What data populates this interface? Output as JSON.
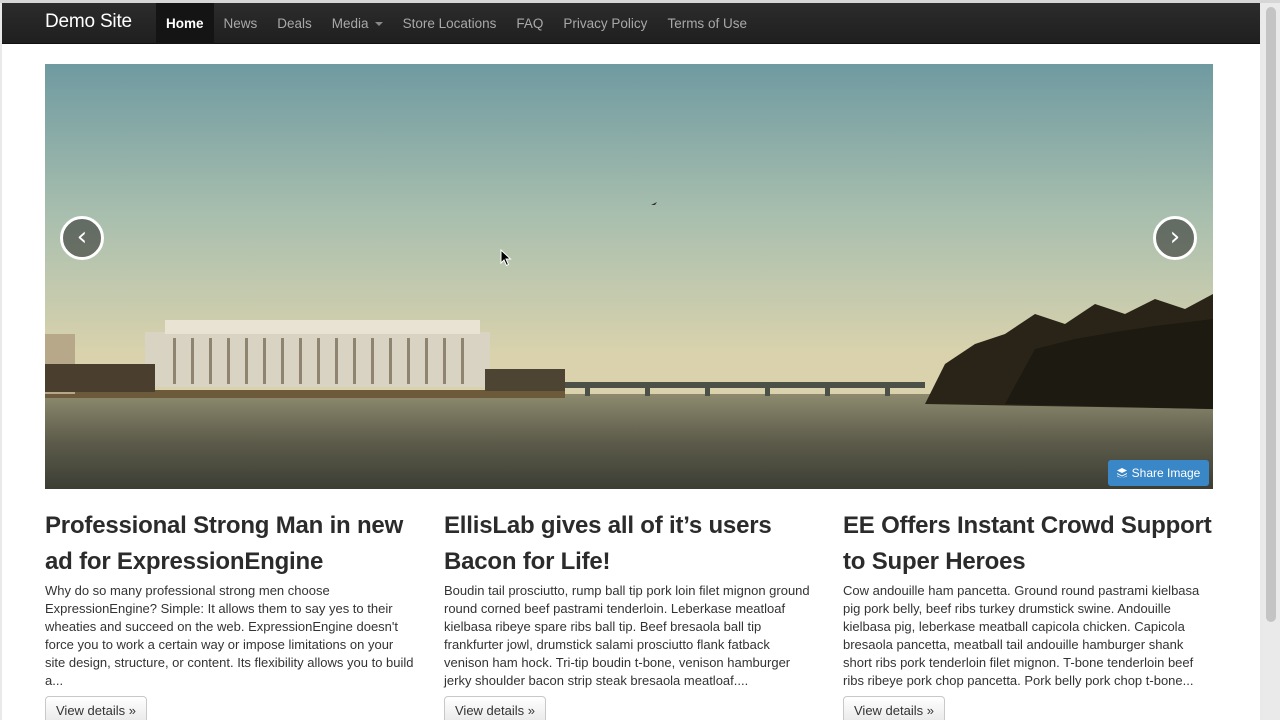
{
  "brand": "Demo Site",
  "nav": {
    "items": [
      {
        "label": "Home"
      },
      {
        "label": "News"
      },
      {
        "label": "Deals"
      },
      {
        "label": "Media"
      },
      {
        "label": "Store Locations"
      },
      {
        "label": "FAQ"
      },
      {
        "label": "Privacy Policy"
      },
      {
        "label": "Terms of Use"
      }
    ],
    "active": "Home"
  },
  "carousel": {
    "prev_label": "‹",
    "next_label": "›",
    "share_label": "Share Image",
    "share_color": "#3a87c7"
  },
  "articles": [
    {
      "title": "Professional Strong Man in new ad for ExpressionEngine",
      "body": "Why do so many professional strong men choose ExpressionEngine? Simple: It allows them to say yes to their wheaties and succeed on the web. ExpressionEngine doesn't force you to work a certain way or impose limitations on your site design, structure, or content. Its flexibility allows you to build a...",
      "button": "View details »"
    },
    {
      "title": "EllisLab gives all of it’s users Bacon for Life!",
      "body": "Boudin tail prosciutto, rump ball tip pork loin filet mignon ground round corned beef pastrami tenderloin. Leberkase meatloaf kielbasa ribeye spare ribs ball tip. Beef bresaola ball tip frankfurter jowl, drumstick salami prosciutto flank fatback venison ham hock. Tri-tip boudin t-bone, venison hamburger jerky shoulder bacon strip steak bresaola meatloaf....",
      "button": "View details »"
    },
    {
      "title": "EE Offers Instant Crowd Support to Super Heroes",
      "body": "Cow andouille ham pancetta. Ground round pastrami kielbasa pig pork belly, beef ribs turkey drumstick swine. Andouille kielbasa pig, leberkase meatball capicola chicken. Capicola bresaola pancetta, meatball tail andouille hamburger shank short ribs pork tenderloin filet mignon. T-bone tenderloin beef ribs ribeye pork chop pancetta. Pork belly pork chop t-bone...",
      "button": "View details »"
    }
  ]
}
